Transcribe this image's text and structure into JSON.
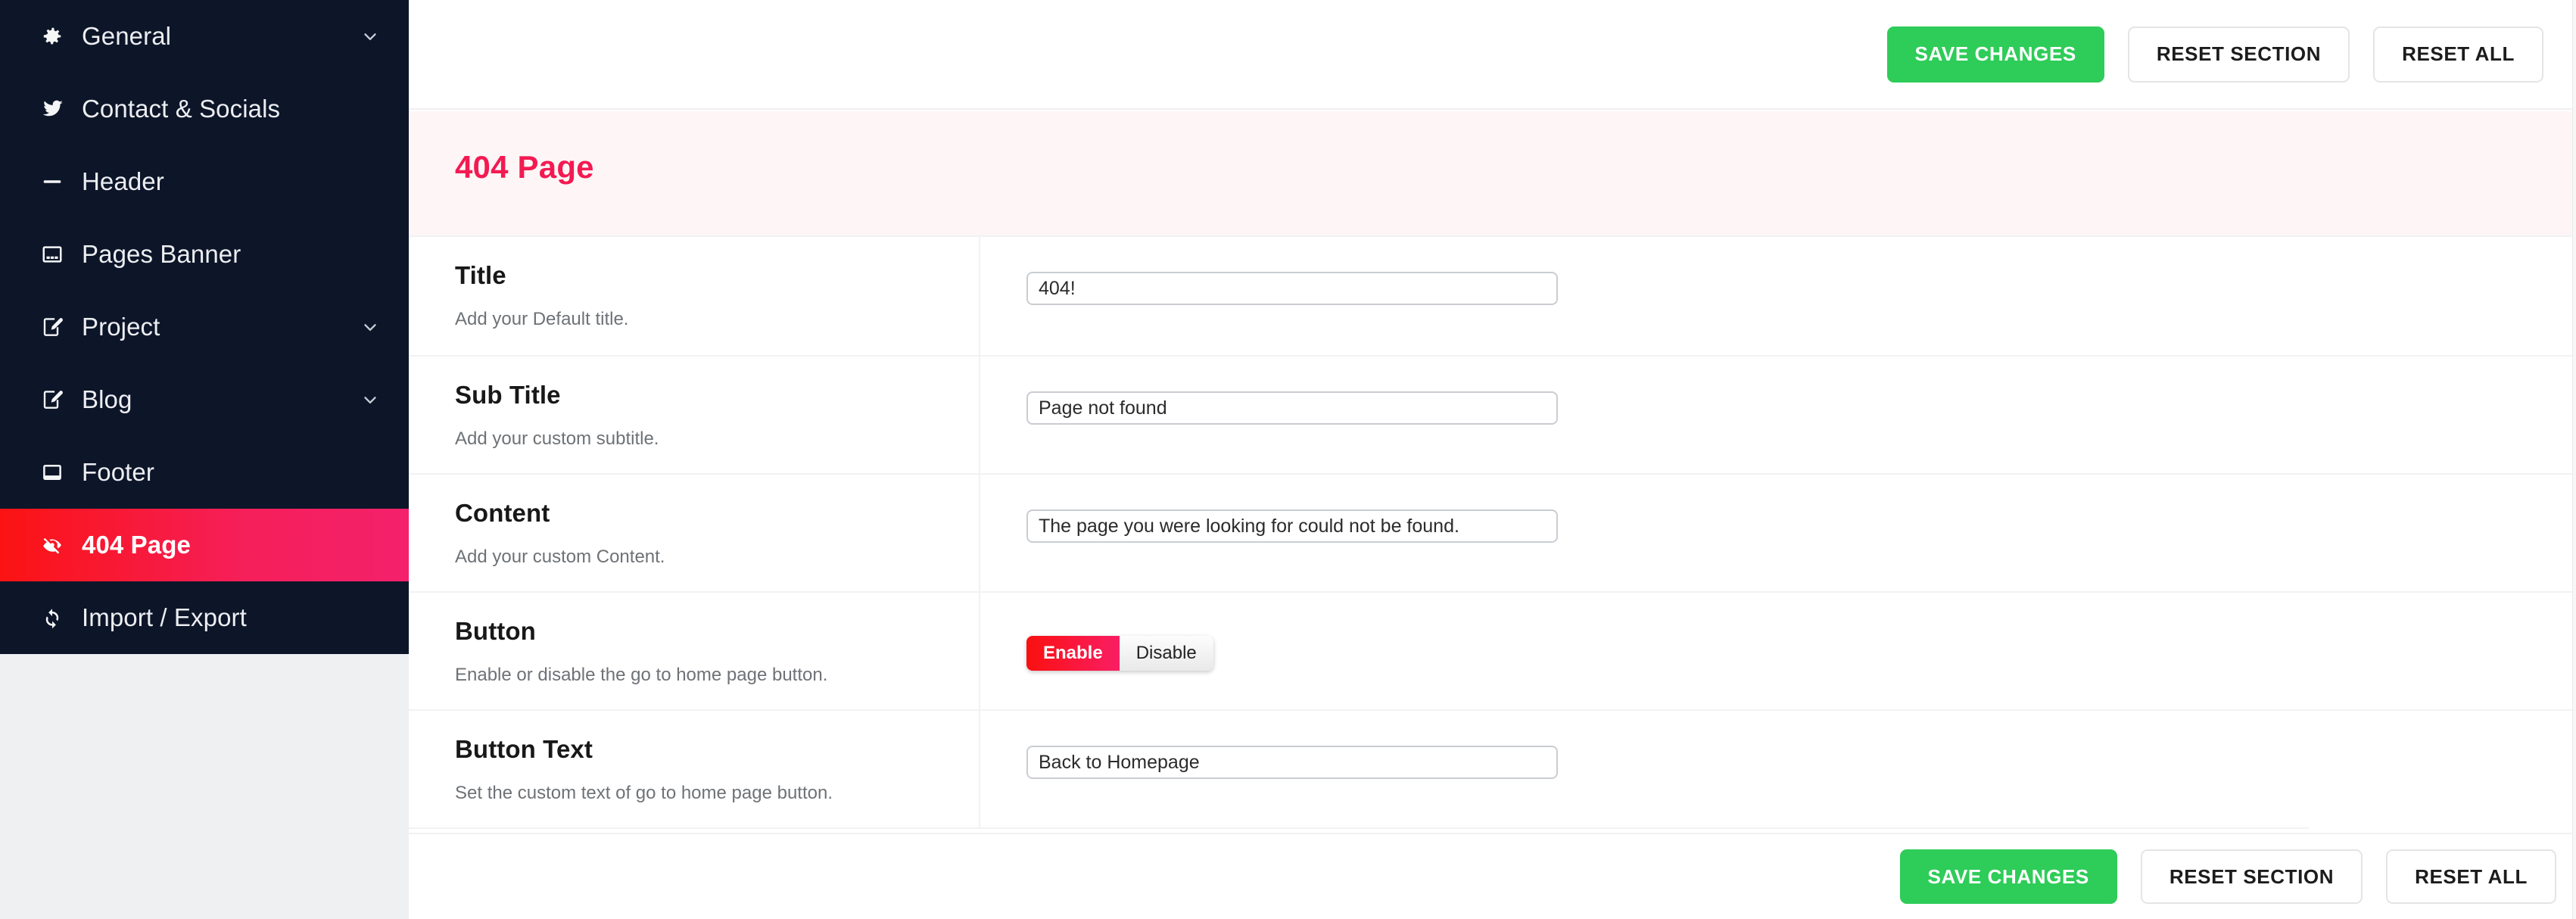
{
  "sidebar": {
    "items": [
      {
        "label": "General",
        "icon": "gear-icon",
        "chevron": true,
        "active": false
      },
      {
        "label": "Contact & Socials",
        "icon": "twitter-icon",
        "chevron": false,
        "active": false
      },
      {
        "label": "Header",
        "icon": "minus-icon",
        "chevron": false,
        "active": false
      },
      {
        "label": "Pages Banner",
        "icon": "banner-icon",
        "chevron": false,
        "active": false
      },
      {
        "label": "Project",
        "icon": "edit-note-icon",
        "chevron": true,
        "active": false
      },
      {
        "label": "Blog",
        "icon": "edit-note-icon",
        "chevron": true,
        "active": false
      },
      {
        "label": "Footer",
        "icon": "footer-icon",
        "chevron": false,
        "active": false
      },
      {
        "label": "404 Page",
        "icon": "eye-slash-icon",
        "chevron": false,
        "active": true
      },
      {
        "label": "Import / Export",
        "icon": "sync-icon",
        "chevron": false,
        "active": false
      }
    ]
  },
  "toolbar": {
    "save_label": "SAVE CHANGES",
    "reset_section_label": "RESET SECTION",
    "reset_all_label": "RESET ALL"
  },
  "bottombar": {
    "save_label": "SAVE CHANGES",
    "reset_section_label": "RESET SECTION",
    "reset_all_label": "RESET ALL"
  },
  "section": {
    "title": "404 Page"
  },
  "fields": [
    {
      "label": "Title",
      "hint": "Add your Default title.",
      "type": "text",
      "value": "404!",
      "placeholder": ""
    },
    {
      "label": "Sub Title",
      "hint": "Add your custom subtitle.",
      "type": "text",
      "value": "Page not found",
      "placeholder": ""
    },
    {
      "label": "Content",
      "hint": "Add your custom Content.",
      "type": "text",
      "value": "The page you were looking for could not be found.",
      "placeholder": ""
    },
    {
      "label": "Button",
      "hint": "Enable or disable the go to home page button.",
      "type": "toggle",
      "options": [
        "Enable",
        "Disable"
      ],
      "selected": "Enable"
    },
    {
      "label": "Button Text",
      "hint": "Set the custom text of go to home page button.",
      "type": "text",
      "value": "Back to Homepage",
      "placeholder": ""
    }
  ],
  "colors": {
    "sidebar_bg": "#0d1529",
    "active_start": "#fb1313",
    "active_end": "#f4206b",
    "accent_pink": "#f31a52",
    "save_green": "#2ecc58",
    "banner_bg": "#fdf5f6"
  }
}
